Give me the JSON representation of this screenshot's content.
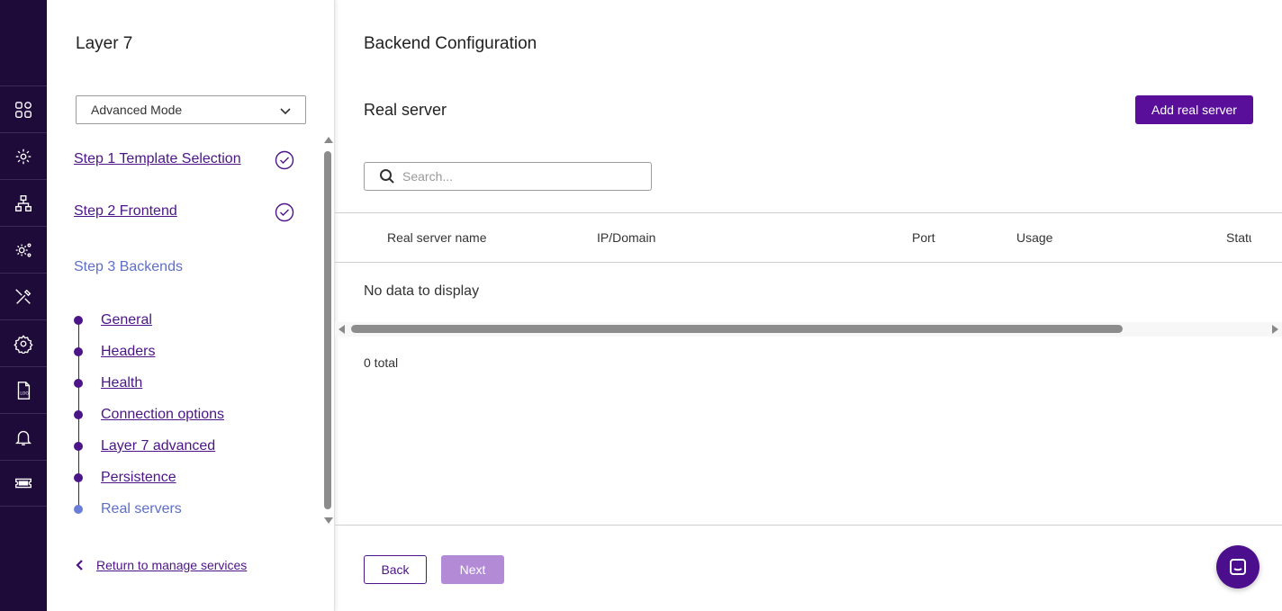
{
  "rail": {
    "items": [
      {
        "icon": "dashboard-icon"
      },
      {
        "icon": "services-gear-icon"
      },
      {
        "icon": "network-icon"
      },
      {
        "icon": "cluster-settings-icon"
      },
      {
        "icon": "tools-icon"
      },
      {
        "icon": "settings-icon"
      },
      {
        "icon": "log-icon",
        "text": "LOG"
      },
      {
        "icon": "bell-icon"
      },
      {
        "icon": "ticket-icon"
      }
    ]
  },
  "wizard": {
    "title": "Layer 7",
    "mode_select": "Advanced Mode",
    "steps": [
      {
        "label": "Step 1 Template Selection",
        "done": true
      },
      {
        "label": "Step 2 Frontend",
        "done": true
      },
      {
        "label": "Step 3 Backends",
        "current": true
      }
    ],
    "substeps": [
      {
        "label": "General"
      },
      {
        "label": "Headers"
      },
      {
        "label": "Health"
      },
      {
        "label": "Connection options"
      },
      {
        "label": "Layer 7 advanced"
      },
      {
        "label": "Persistence"
      },
      {
        "label": "Real servers",
        "active": true
      }
    ],
    "return_link": "Return to manage services"
  },
  "main": {
    "title": "Backend Configuration",
    "section_title": "Real server",
    "add_button": "Add real server",
    "search_placeholder": "Search...",
    "columns": [
      "Real server name",
      "IP/Domain",
      "Port",
      "Usage",
      "Statu"
    ],
    "empty_message": "No data to display",
    "total_text": "0 total",
    "back_button": "Back",
    "next_button": "Next"
  },
  "colors": {
    "rail_bg": "#1e0b3a",
    "primary": "#5a0f9a",
    "link": "#4b1487",
    "disabled": "#b28ad6",
    "current_step": "#5e6fc7"
  }
}
